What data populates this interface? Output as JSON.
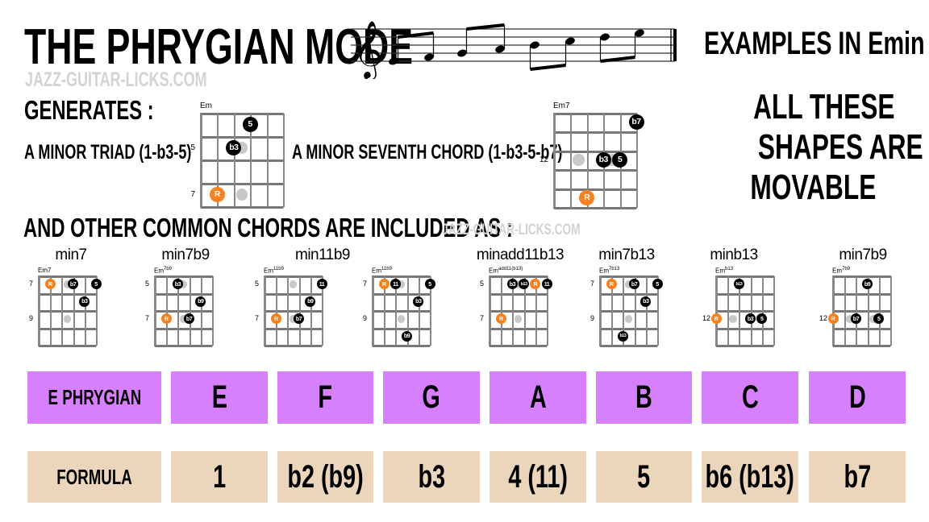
{
  "header": {
    "title": "THE PHRYGIAN MODE",
    "site": "JAZZ-GUITAR-LICKS.COM",
    "examples": "EXAMPLES IN Emin",
    "movable": [
      "ALL THESE",
      "SHAPES ARE",
      "MOVABLE"
    ]
  },
  "staff": {
    "clef": "treble",
    "notes": [
      "E4",
      "F4",
      "G4",
      "A4",
      "B4",
      "C5",
      "D5",
      "E5"
    ]
  },
  "generates": {
    "heading": "GENERATES :",
    "triad_text": "A MINOR TRIAD (1-b3-5)",
    "seventh_text": "A MINOR SEVENTH CHORD (1-b3-5-b7)"
  },
  "other": {
    "heading": "AND OTHER COMMON CHORDS ARE INCLUDED AS :",
    "site": "JAZZ-GUITAR-LICKS.COM"
  },
  "colors": {
    "root": "#f58220",
    "tone": "#000000",
    "ghost": "#c8c8c8",
    "scale_row": "#d680fe",
    "formula_row": "#ebd5bb"
  },
  "main_chords": [
    {
      "name": "Em",
      "sup": "",
      "rows": 4,
      "frets": {
        "1": "5",
        "3": "7"
      },
      "dots": [
        {
          "s": 2.5,
          "f": 1,
          "t": "g"
        },
        {
          "s": 2.5,
          "f": 3,
          "t": "g"
        },
        {
          "s": 3,
          "f": 0,
          "t": "n",
          "l": "5"
        },
        {
          "s": 2,
          "f": 1,
          "t": "n",
          "l": "b3"
        },
        {
          "s": 1,
          "f": 3,
          "t": "r",
          "l": "R"
        }
      ]
    },
    {
      "name": "Em7",
      "sup": "",
      "rows": 5,
      "frets": {
        "2": "12"
      },
      "dots": [
        {
          "s": 1.5,
          "f": 2,
          "t": "g"
        },
        {
          "s": 3.5,
          "f": 2,
          "t": "g"
        },
        {
          "s": 5,
          "f": 0,
          "t": "n",
          "l": "b7"
        },
        {
          "s": 3,
          "f": 2,
          "t": "n",
          "l": "b3"
        },
        {
          "s": 4,
          "f": 2,
          "t": "n",
          "l": "5"
        },
        {
          "s": 2,
          "f": 4,
          "t": "r",
          "l": "R"
        }
      ]
    }
  ],
  "chord_titles": [
    "min7",
    "min7b9",
    "min11b9",
    "minadd11b13",
    "min7b13",
    "minb13",
    "min7b9"
  ],
  "chords": [
    {
      "name": "Em7",
      "sup": "",
      "frets": {
        "0": "7",
        "2": "9"
      },
      "dots": [
        {
          "s": 2.5,
          "f": 0,
          "t": "g"
        },
        {
          "s": 2.5,
          "f": 2,
          "t": "g"
        },
        {
          "s": 1,
          "f": 0,
          "t": "r",
          "l": "R"
        },
        {
          "s": 3,
          "f": 0,
          "t": "n",
          "l": "b7"
        },
        {
          "s": 5,
          "f": 0,
          "t": "n",
          "l": "5"
        },
        {
          "s": 4,
          "f": 1,
          "t": "n",
          "l": "b3"
        }
      ]
    },
    {
      "name": "Em",
      "sup": "7b9",
      "frets": {
        "0": "5",
        "2": "7"
      },
      "dots": [
        {
          "s": 2.5,
          "f": 0,
          "t": "g"
        },
        {
          "s": 2.5,
          "f": 2,
          "t": "g"
        },
        {
          "s": 2,
          "f": 0,
          "t": "n",
          "l": "b3"
        },
        {
          "s": 4,
          "f": 1,
          "t": "n",
          "l": "b9"
        },
        {
          "s": 1,
          "f": 2,
          "t": "r",
          "l": "R"
        },
        {
          "s": 3,
          "f": 2,
          "t": "n",
          "l": "b7"
        }
      ]
    },
    {
      "name": "Em",
      "sup": "11b9",
      "frets": {
        "0": "5",
        "2": "7"
      },
      "dots": [
        {
          "s": 2.5,
          "f": 0,
          "t": "g"
        },
        {
          "s": 2.5,
          "f": 2,
          "t": "g"
        },
        {
          "s": 5,
          "f": 0,
          "t": "n",
          "l": "11"
        },
        {
          "s": 4,
          "f": 1,
          "t": "n",
          "l": "b9"
        },
        {
          "s": 1,
          "f": 2,
          "t": "r",
          "l": "R"
        },
        {
          "s": 3,
          "f": 2,
          "t": "n",
          "l": "b7"
        }
      ]
    },
    {
      "name": "Em",
      "sup": "11b9",
      "frets": {
        "0": "7",
        "2": "9"
      },
      "dots": [
        {
          "s": 2.5,
          "f": 0,
          "t": "g"
        },
        {
          "s": 2.5,
          "f": 2,
          "t": "g"
        },
        {
          "s": 1,
          "f": 0,
          "t": "r",
          "l": "R"
        },
        {
          "s": 2,
          "f": 0,
          "t": "n",
          "l": "11"
        },
        {
          "s": 5,
          "f": 0,
          "t": "n",
          "l": "5"
        },
        {
          "s": 4,
          "f": 1,
          "t": "n",
          "l": "b3"
        },
        {
          "s": 3,
          "f": 3,
          "t": "n",
          "l": "b9"
        }
      ]
    },
    {
      "name": "Em",
      "sup": "add11(b13)",
      "frets": {
        "0": "5",
        "2": "7"
      },
      "dots": [
        {
          "s": 2.5,
          "f": 0,
          "t": "g"
        },
        {
          "s": 2.5,
          "f": 2,
          "t": "g"
        },
        {
          "s": 2,
          "f": 0,
          "t": "n",
          "l": "b3"
        },
        {
          "s": 3,
          "f": 0,
          "t": "n",
          "l": "b13"
        },
        {
          "s": 4,
          "f": 0,
          "t": "r",
          "l": "R"
        },
        {
          "s": 5,
          "f": 0,
          "t": "n",
          "l": "11"
        },
        {
          "s": 1,
          "f": 2,
          "t": "r",
          "l": "R"
        }
      ]
    },
    {
      "name": "Em",
      "sup": "7b13",
      "frets": {
        "0": "7",
        "2": "9"
      },
      "dots": [
        {
          "s": 2.5,
          "f": 0,
          "t": "g"
        },
        {
          "s": 2.5,
          "f": 2,
          "t": "g"
        },
        {
          "s": 1,
          "f": 0,
          "t": "r",
          "l": "R"
        },
        {
          "s": 3,
          "f": 0,
          "t": "n",
          "l": "b7"
        },
        {
          "s": 5,
          "f": 0,
          "t": "n",
          "l": "5"
        },
        {
          "s": 4,
          "f": 1,
          "t": "n",
          "l": "b3"
        },
        {
          "s": 2,
          "f": 3,
          "t": "n",
          "l": "b13"
        }
      ]
    },
    {
      "name": "Em",
      "sup": "b13",
      "frets": {
        "2": "12"
      },
      "dots": [
        {
          "s": 1.5,
          "f": 2,
          "t": "g"
        },
        {
          "s": 2,
          "f": 0,
          "t": "n",
          "l": "b13"
        },
        {
          "s": 0,
          "f": 2,
          "t": "r",
          "l": "R"
        },
        {
          "s": 3,
          "f": 2,
          "t": "n",
          "l": "b3"
        },
        {
          "s": 4,
          "f": 2,
          "t": "n",
          "l": "5"
        }
      ]
    },
    {
      "name": "Em",
      "sup": "7b9",
      "frets": {
        "2": "12"
      },
      "dots": [
        {
          "s": 1.5,
          "f": 2,
          "t": "g"
        },
        {
          "s": 3.5,
          "f": 2,
          "t": "g"
        },
        {
          "s": 3,
          "f": 0,
          "t": "n",
          "l": "b9"
        },
        {
          "s": 0,
          "f": 2,
          "t": "r",
          "l": "R"
        },
        {
          "s": 2,
          "f": 2,
          "t": "n",
          "l": "b7"
        },
        {
          "s": 4,
          "f": 2,
          "t": "n",
          "l": "5"
        }
      ]
    }
  ],
  "table": {
    "scale_label": "E PHRYGIAN",
    "notes": [
      "E",
      "F",
      "G",
      "A",
      "B",
      "C",
      "D"
    ],
    "formula_label": "FORMULA",
    "formula": [
      "1",
      "b2 (b9)",
      "b3",
      "4 (11)",
      "5",
      "b6 (b13)",
      "b7"
    ]
  }
}
